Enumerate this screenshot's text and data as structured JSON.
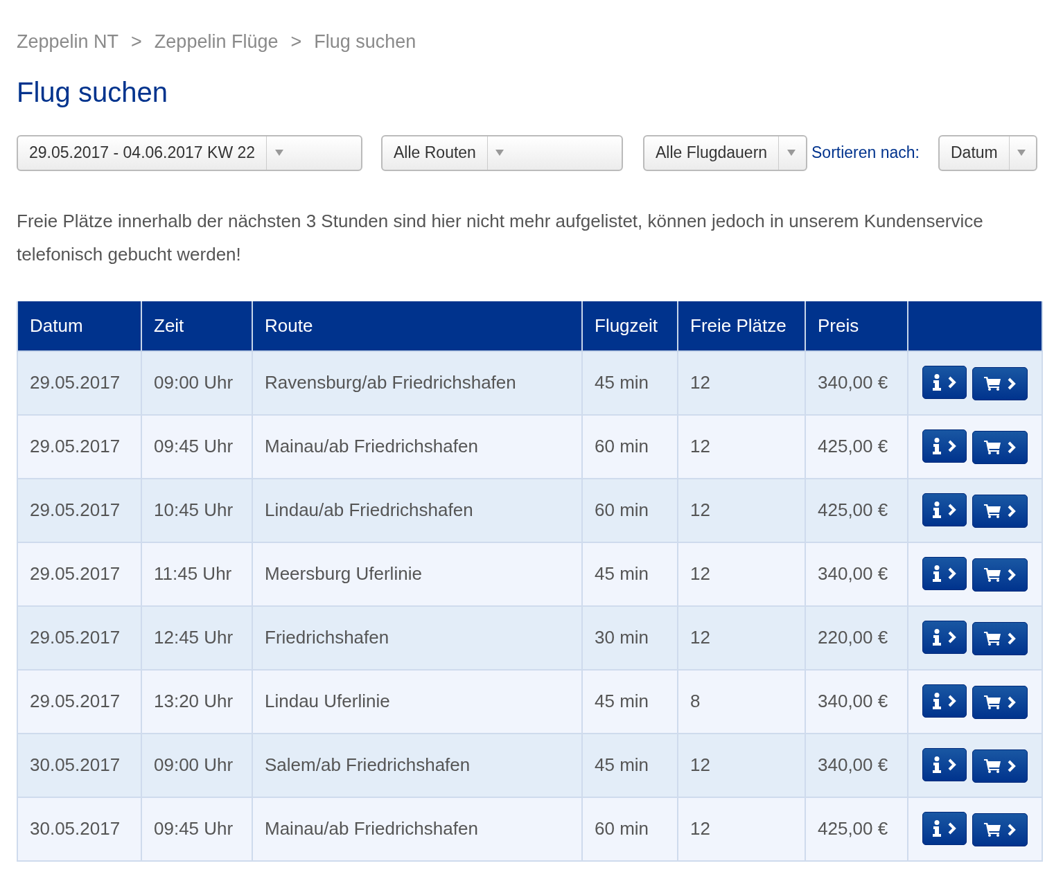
{
  "breadcrumb": [
    "Zeppelin NT",
    "Zeppelin Flüge",
    "Flug suchen"
  ],
  "breadcrumb_separator": ">",
  "title": "Flug suchen",
  "filters": [
    {
      "value": "29.05.2017 - 04.06.2017 KW 22"
    },
    {
      "value": "Alle Routen"
    },
    {
      "value": "Alle Flugdauern"
    }
  ],
  "sort": {
    "label": "Sortieren nach:",
    "value": "Datum"
  },
  "notice": "Freie Plätze innerhalb der nächsten 3 Stunden sind hier nicht mehr aufgelistet, können jedoch in unserem Kundenservice telefonisch gebucht werden!",
  "table": {
    "columns": [
      "Datum",
      "Zeit",
      "Route",
      "Flugzeit",
      "Freie Plätze",
      "Preis"
    ],
    "rows": [
      {
        "date": "29.05.2017",
        "time": "09:00 Uhr",
        "route": "Ravensburg/ab Friedrichshafen",
        "duration": "45 min",
        "seats": "12",
        "price": "340,00 €"
      },
      {
        "date": "29.05.2017",
        "time": "09:45 Uhr",
        "route": "Mainau/ab Friedrichshafen",
        "duration": "60 min",
        "seats": "12",
        "price": "425,00 €"
      },
      {
        "date": "29.05.2017",
        "time": "10:45 Uhr",
        "route": "Lindau/ab Friedrichshafen",
        "duration": "60 min",
        "seats": "12",
        "price": "425,00 €"
      },
      {
        "date": "29.05.2017",
        "time": "11:45 Uhr",
        "route": "Meersburg Uferlinie",
        "duration": "45 min",
        "seats": "12",
        "price": "340,00 €"
      },
      {
        "date": "29.05.2017",
        "time": "12:45 Uhr",
        "route": "Friedrichshafen",
        "duration": "30 min",
        "seats": "12",
        "price": "220,00 €"
      },
      {
        "date": "29.05.2017",
        "time": "13:20 Uhr",
        "route": "Lindau Uferlinie",
        "duration": "45 min",
        "seats": "8",
        "price": "340,00 €"
      },
      {
        "date": "30.05.2017",
        "time": "09:00 Uhr",
        "route": "Salem/ab Friedrichshafen",
        "duration": "45 min",
        "seats": "12",
        "price": "340,00 €"
      },
      {
        "date": "30.05.2017",
        "time": "09:45 Uhr",
        "route": "Mainau/ab Friedrichshafen",
        "duration": "60 min",
        "seats": "12",
        "price": "425,00 €"
      }
    ]
  }
}
